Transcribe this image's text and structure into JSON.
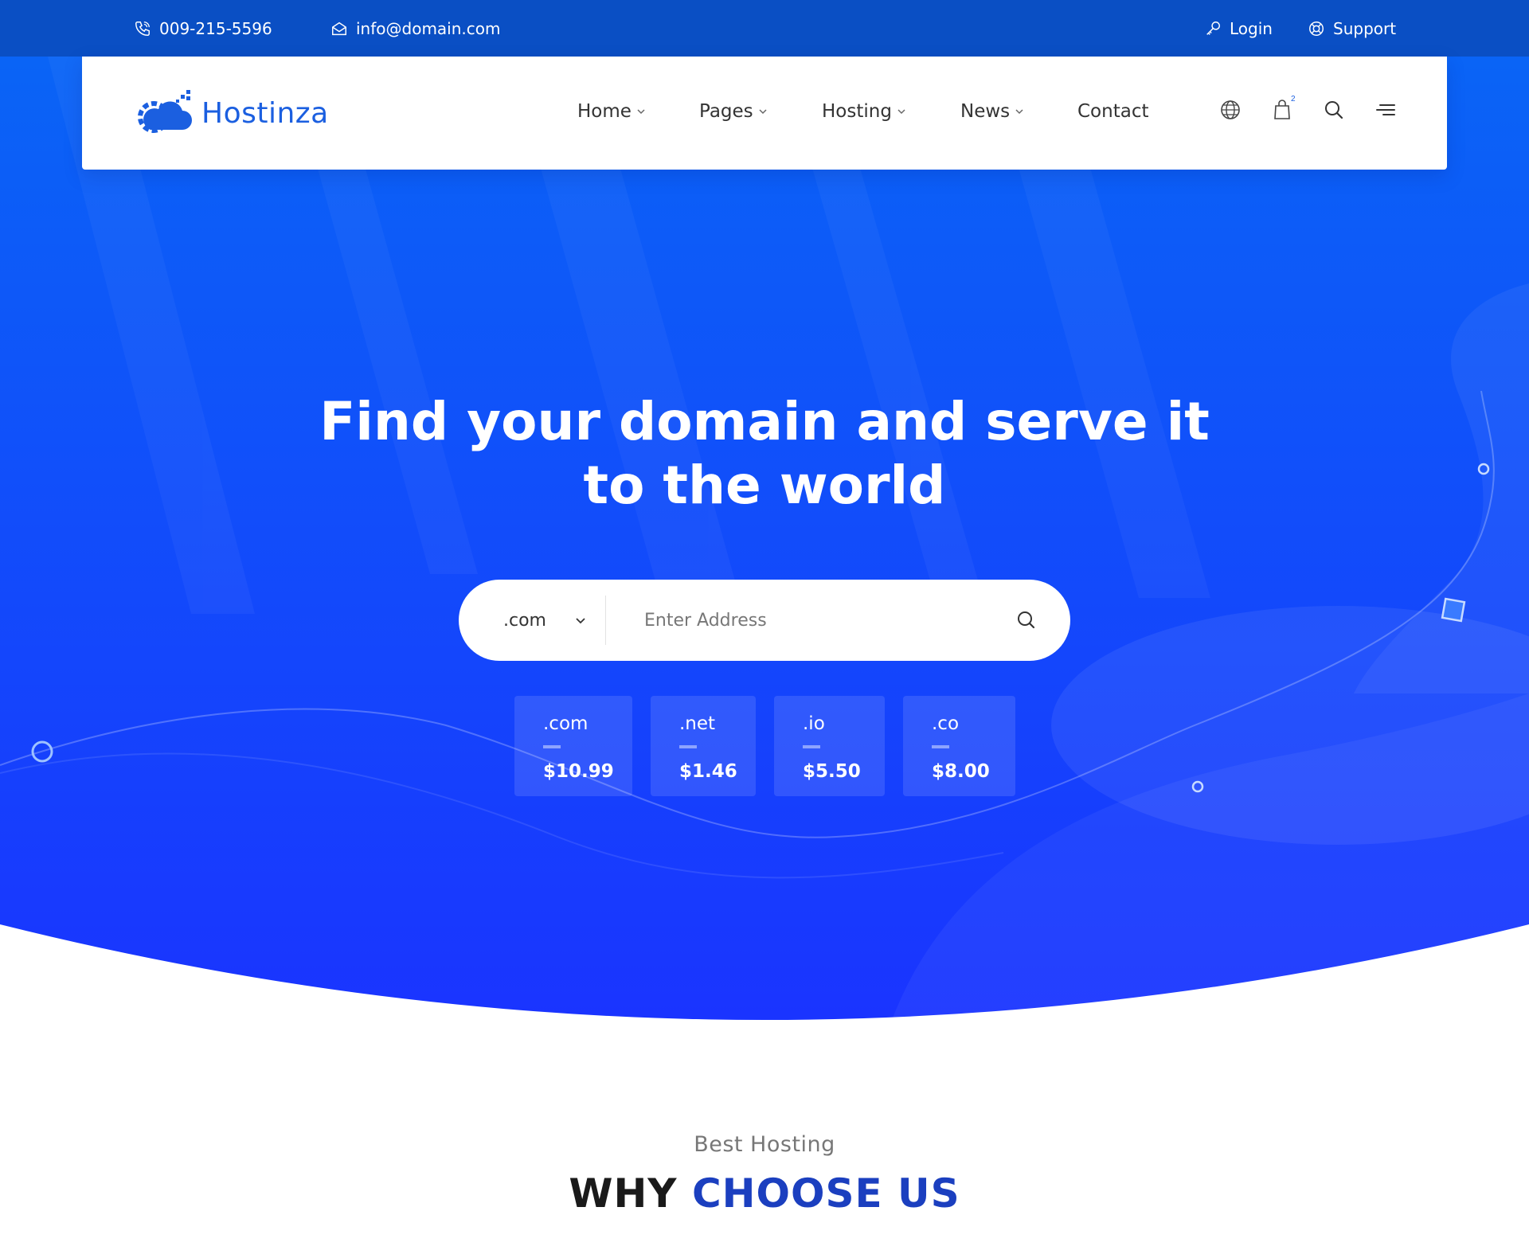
{
  "topbar": {
    "phone": "009-215-5596",
    "email": "info@domain.com",
    "login": "Login",
    "support": "Support"
  },
  "brand": {
    "name": "Hostinza"
  },
  "nav": {
    "items": [
      {
        "label": "Home",
        "has_dropdown": true
      },
      {
        "label": "Pages",
        "has_dropdown": true
      },
      {
        "label": "Hosting",
        "has_dropdown": true
      },
      {
        "label": "News",
        "has_dropdown": true
      },
      {
        "label": "Contact",
        "has_dropdown": false
      }
    ],
    "cart_count": "2",
    "icons": [
      "globe-icon",
      "cart-icon",
      "search-icon",
      "menu-icon"
    ]
  },
  "hero": {
    "headline_line1": "Find your domain and serve it",
    "headline_line2": "to the world",
    "search": {
      "tld_selected": ".com",
      "placeholder": "Enter Address"
    },
    "prices": [
      {
        "ext": ".com",
        "price": "$10.99"
      },
      {
        "ext": ".net",
        "price": "$1.46"
      },
      {
        "ext": ".io",
        "price": "$5.50"
      },
      {
        "ext": ".co",
        "price": "$8.00"
      }
    ]
  },
  "section": {
    "subtitle": "Best Hosting",
    "title_part1": "WHY",
    "title_part2": "CHOOSE US"
  },
  "colors": {
    "topbar": "#0a4fc4",
    "hero_top": "#0b5bf5",
    "hero_bottom": "#1a35ff",
    "brand_blue": "#1b5fe0",
    "title_accent": "#1b3fbf"
  }
}
